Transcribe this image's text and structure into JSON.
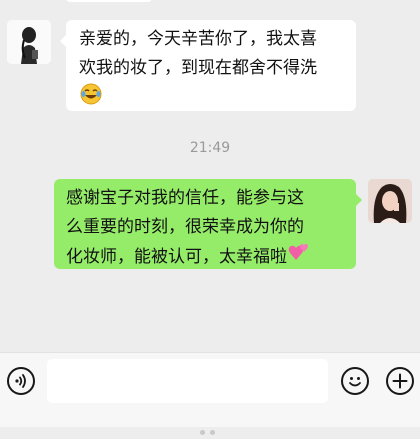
{
  "chat": {
    "incoming_message": {
      "lines": [
        "亲爱的，今天辛苦你了，我太喜",
        "欢我的妆了，到现在都舍不得洗"
      ],
      "trailing_emoji_icon": "laughing-crying-emoji-icon"
    },
    "timestamp": "21:49",
    "outgoing_message": {
      "lines": [
        "感谢宝子对我的信任，能参与这",
        "么重要的时刻，很荣幸成为你的",
        "化妆师，能被认可，太幸福啦"
      ],
      "trailing_emoji_icon": "two-hearts-emoji-icon"
    }
  },
  "input_bar": {
    "voice_icon": "voice-icon",
    "text_value": "",
    "emoji_icon": "smiley-icon",
    "more_icon": "plus-circle-icon"
  },
  "colors": {
    "chat_background": "#ededed",
    "outgoing_bubble": "#95ec69",
    "incoming_bubble": "#ffffff",
    "timestamp_text": "#9a9a9a"
  }
}
